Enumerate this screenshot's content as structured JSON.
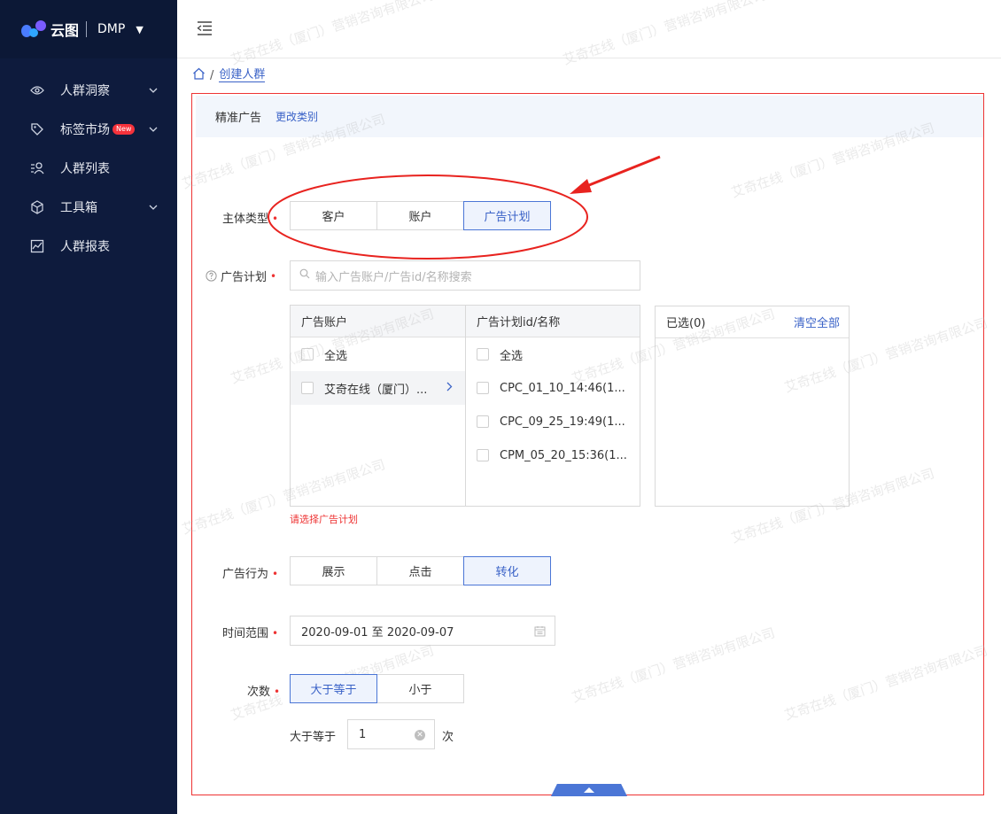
{
  "app": {
    "logo_text": "云图",
    "product": "DMP"
  },
  "sidebar": {
    "items": [
      {
        "label": "人群洞察",
        "icon": "eye-icon",
        "has_chevron": true
      },
      {
        "label": "标签市场",
        "icon": "tag-icon",
        "has_chevron": true,
        "badge": "New"
      },
      {
        "label": "人群列表",
        "icon": "people-list-icon",
        "has_chevron": false
      },
      {
        "label": "工具箱",
        "icon": "cube-icon",
        "has_chevron": true
      },
      {
        "label": "人群报表",
        "icon": "chart-icon",
        "has_chevron": false
      }
    ]
  },
  "breadcrumb": {
    "current": "创建人群"
  },
  "panel": {
    "type_label": "精准广告",
    "change_link": "更改类别"
  },
  "form": {
    "subject_type": {
      "label": "主体类型",
      "options": [
        "客户",
        "账户",
        "广告计划"
      ],
      "selected": "广告计划"
    },
    "ad_plan": {
      "label": "广告计划",
      "search_placeholder": "输入广告账户/广告id/名称搜索",
      "col1_header": "广告账户",
      "col2_header": "广告计划id/名称",
      "col1_rows": [
        "全选",
        "艾奇在线（厦门）..."
      ],
      "col2_rows": [
        "全选",
        "CPC_01_10_14:46(1...",
        "CPC_09_25_19:49(1...",
        "CPM_05_20_15:36(1..."
      ],
      "selected_header": "已选(0)",
      "clear_all": "清空全部",
      "error": "请选择广告计划"
    },
    "ad_behavior": {
      "label": "广告行为",
      "options": [
        "展示",
        "点击",
        "转化"
      ],
      "selected": "转化"
    },
    "time_range": {
      "label": "时间范围",
      "value": "2020-09-01 至 2020-09-07"
    },
    "count": {
      "label": "次数",
      "options": [
        "大于等于",
        "小于"
      ],
      "selected": "大于等于",
      "prefix": "大于等于",
      "value": "1",
      "suffix": "次"
    }
  },
  "watermark": "艾奇在线（厦门）营销咨询有限公司",
  "colors": {
    "sidebar_bg": "#0e1b3d",
    "accent": "#3a62c7",
    "error": "#ee3333"
  }
}
